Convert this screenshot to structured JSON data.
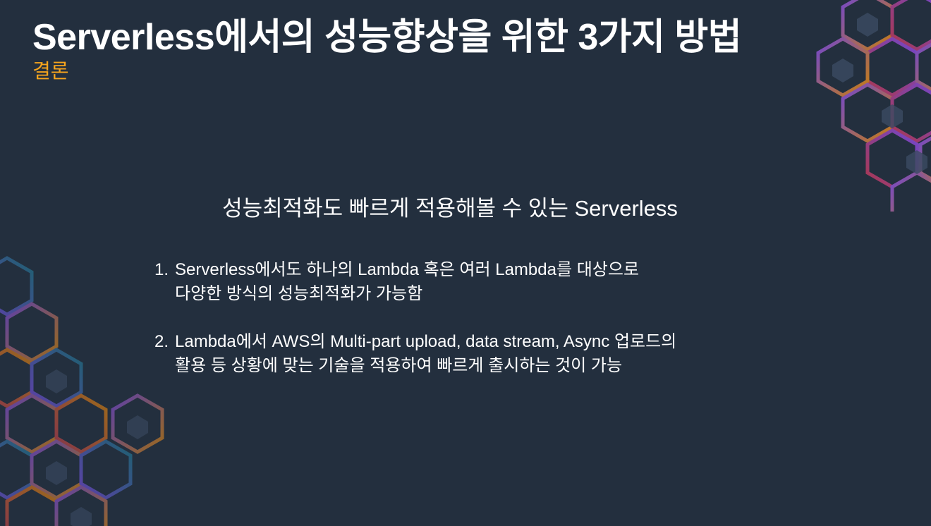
{
  "slide": {
    "title": "Serverless에서의 성능향상을 위한 3가지 방법",
    "subtitle": "결론",
    "heading": "성능최적화도 빠르게 적용해볼 수 있는 Serverless",
    "points": [
      {
        "number": "1.",
        "lines": [
          "Serverless에서도 하나의 Lambda 혹은 여러 Lambda를 대상으로",
          "다양한 방식의 성능최적화가 가능함"
        ]
      },
      {
        "number": "2.",
        "lines": [
          "Lambda에서 AWS의 Multi-part upload, data stream, Async 업로드의",
          "활용 등 상황에 맞는 기술을 적용하여 빠르게 출시하는 것이 가능"
        ]
      }
    ]
  },
  "colors": {
    "background": "#232f3e",
    "text": "#ffffff",
    "subtitle_accent": "#f7a51d",
    "hex_purple": "#8c4fff",
    "hex_orange": "#ff9900",
    "hex_teal": "#1a8a9a",
    "hex_red": "#d83b54"
  },
  "decorations": {
    "top_right": "hexagon-pattern",
    "bottom_left": "hexagon-pattern"
  }
}
